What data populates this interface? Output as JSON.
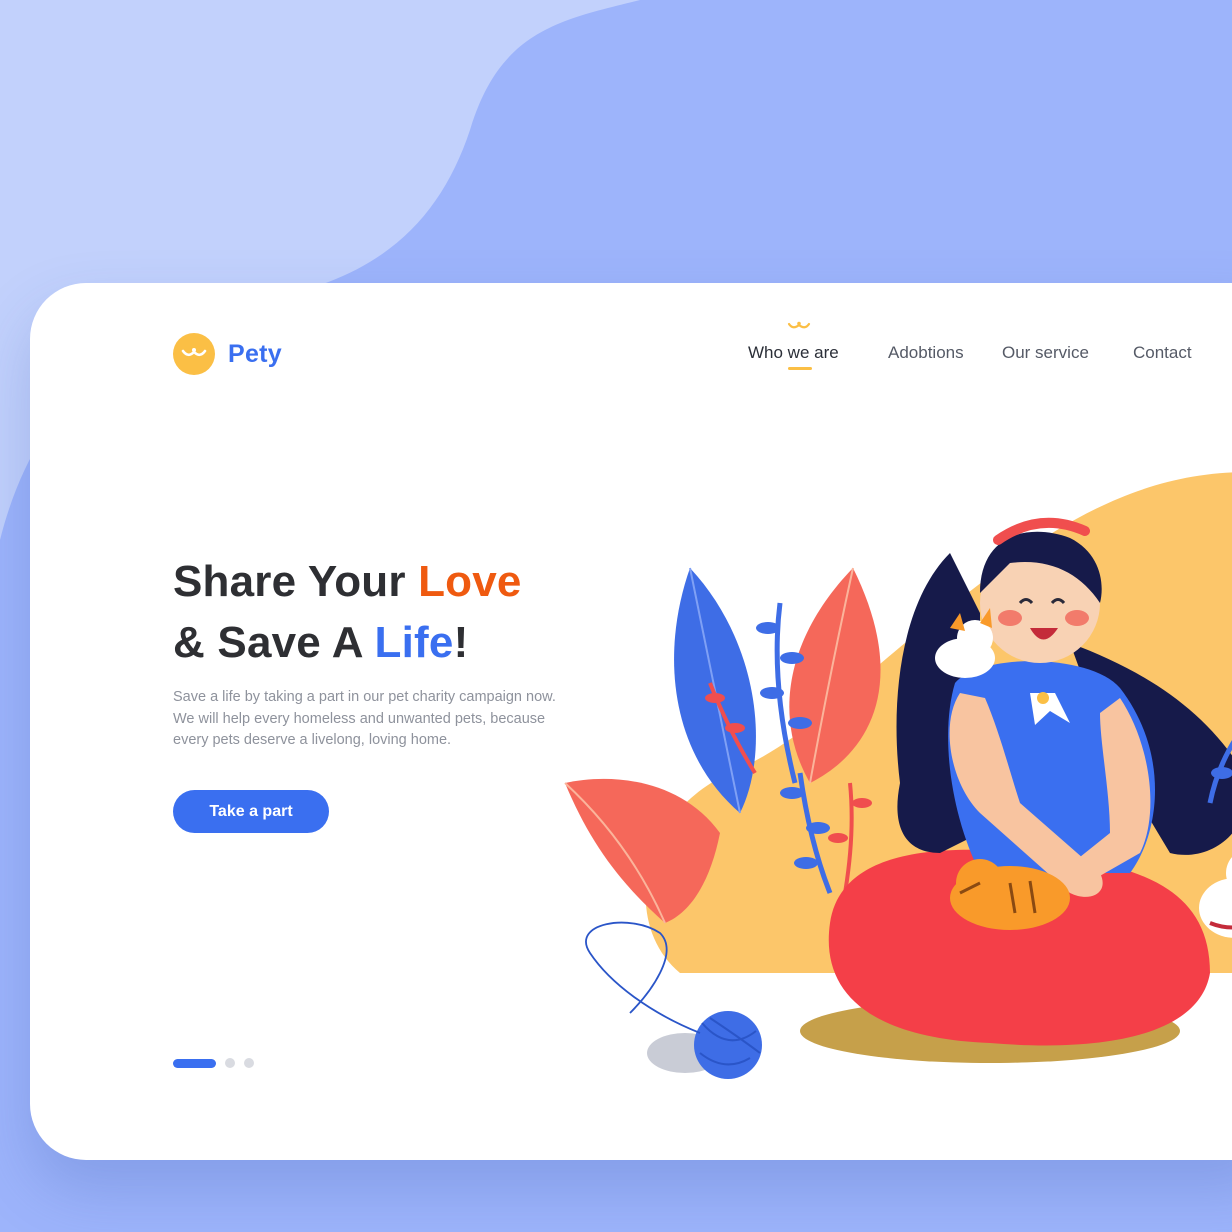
{
  "brand": {
    "name": "Pety",
    "logo_icon": "cat-face-icon",
    "color": "#3a6ff0",
    "badge_color": "#fbbf45"
  },
  "nav": {
    "items": [
      {
        "label": "Who we are",
        "active": true
      },
      {
        "label": "Adobtions",
        "active": false
      },
      {
        "label": "Our service",
        "active": false
      },
      {
        "label": "Contact",
        "active": false
      }
    ],
    "active_marker_icon": "cat-whisker-icon"
  },
  "hero": {
    "headline_line1_a": "Share Your ",
    "headline_line1_b": "Love",
    "headline_line2_a": "& Save A ",
    "headline_line2_b": "Life",
    "headline_line2_c": "!",
    "description": "Save a life by taking a part in our pet charity campaign now. We will help every homeless and unwanted pets, because every pets deserve a livelong, loving home.",
    "cta_label": "Take a part"
  },
  "slider": {
    "total": 3,
    "active_index": 0
  },
  "colors": {
    "accent_blue": "#3a6ff0",
    "accent_orange": "#ef5a10",
    "yellow": "#fbbf45",
    "background": "#9db4fb"
  }
}
